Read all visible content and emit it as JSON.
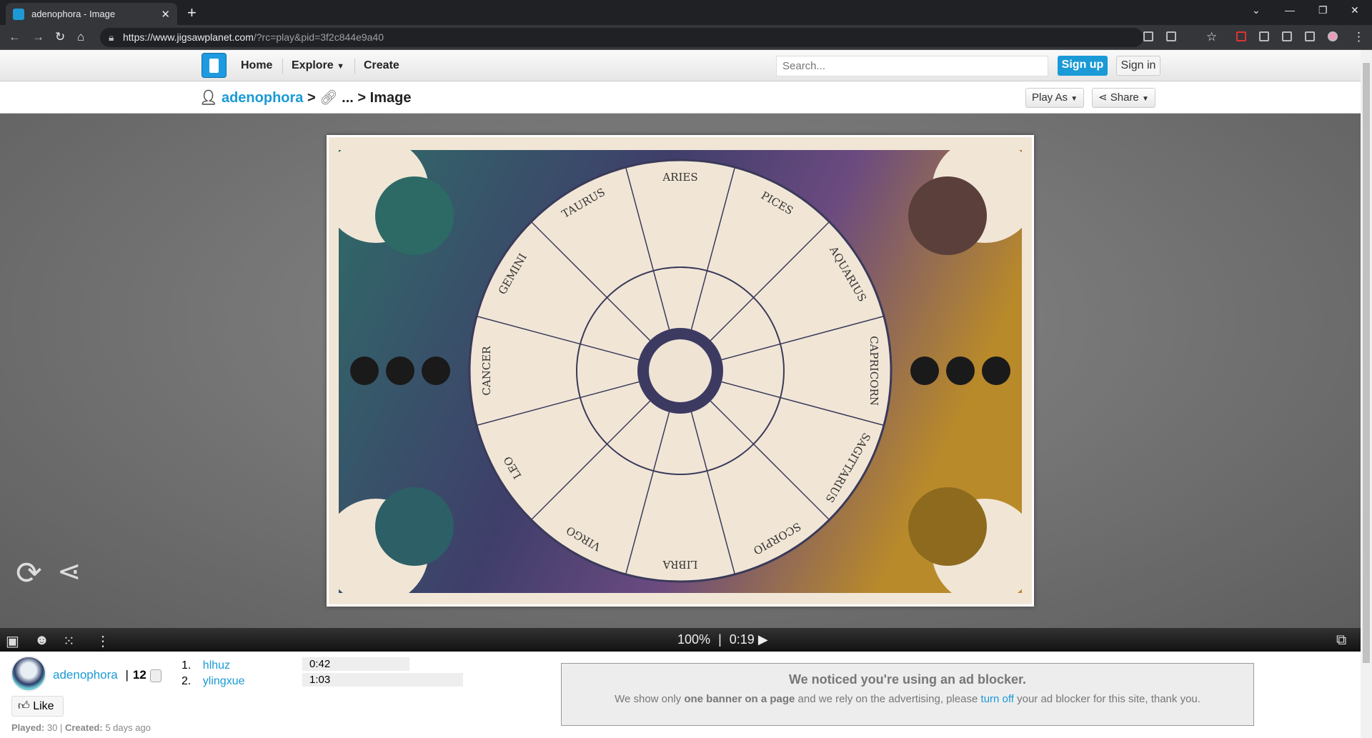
{
  "browser": {
    "tab_title": "adenophora - Image",
    "url_host": "https://www.jigsawplanet.com",
    "url_path": "/?rc=play&pid=3f2c844e9a40"
  },
  "header": {
    "nav": [
      "Home",
      "Explore",
      "Create"
    ],
    "search_placeholder": "Search...",
    "signup": "Sign up",
    "signin": "Sign in"
  },
  "breadcrumb": {
    "user": "adenophora",
    "sep1": ">",
    "ellipsis": "...",
    "sep2": ">",
    "current": "Image",
    "play_as": "Play As",
    "share": "Share"
  },
  "puzzle": {
    "signs": [
      "ARIES",
      "PICES",
      "AQUARIUS",
      "CAPRICORN",
      "SAGITTARIUS",
      "SCORPIO",
      "LIBRA",
      "VIRGO",
      "LEO",
      "CANCER",
      "GEMINI",
      "TAURUS"
    ]
  },
  "toolbar": {
    "zoom": "100%",
    "divider": "|",
    "timer": "0:19"
  },
  "info": {
    "user": "adenophora",
    "pieces": "12",
    "like": "Like",
    "played_label": "Played:",
    "played": "30",
    "created_label": "Created:",
    "created": "5 days ago"
  },
  "scores": [
    {
      "rank": "1.",
      "name": "hlhuz",
      "time": "0:42"
    },
    {
      "rank": "2.",
      "name": "ylingxue",
      "time": "1:03"
    }
  ],
  "ad": {
    "title": "We noticed you're using an ad blocker.",
    "t1": "We show only ",
    "bold": "one banner on a page",
    "t2": " and we rely on the advertising, please ",
    "link": "turn off",
    "t3": " your ad blocker for this site, thank you."
  }
}
